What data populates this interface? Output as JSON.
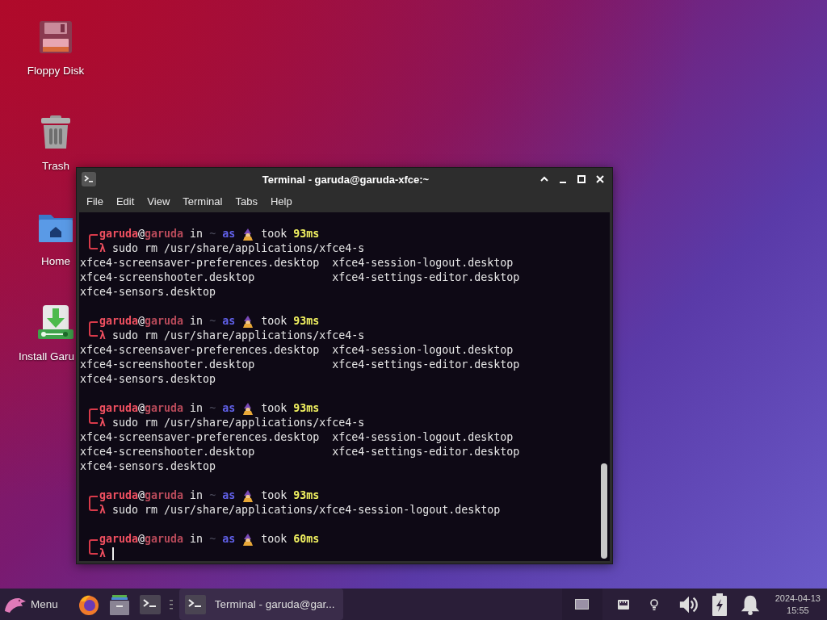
{
  "desktop_icons": [
    {
      "kind": "floppy",
      "label": "Floppy Disk"
    },
    {
      "kind": "trash",
      "label": "Trash"
    },
    {
      "kind": "home",
      "label": "Home"
    },
    {
      "kind": "installer",
      "label": "Install Garu"
    }
  ],
  "terminal": {
    "title": "Terminal - garuda@garuda-xfce:~",
    "menu": [
      "File",
      "Edit",
      "View",
      "Terminal",
      "Tabs",
      "Help"
    ],
    "blocks": [
      {
        "user": "garuda",
        "at": "@",
        "host": "garuda",
        "in": "in",
        "dir": "~",
        "as": "as",
        "took": "took",
        "time": "93ms",
        "lambda": "λ",
        "command": "sudo rm /usr/share/applications/xfce4-s",
        "output": [
          [
            "xfce4-screensaver-preferences.desktop",
            "xfce4-session-logout.desktop"
          ],
          [
            "xfce4-screenshooter.desktop",
            "xfce4-settings-editor.desktop"
          ],
          [
            "xfce4-sensors.desktop"
          ]
        ],
        "cursor": false
      },
      {
        "user": "garuda",
        "at": "@",
        "host": "garuda",
        "in": "in",
        "dir": "~",
        "as": "as",
        "took": "took",
        "time": "93ms",
        "lambda": "λ",
        "command": "sudo rm /usr/share/applications/xfce4-s",
        "output": [
          [
            "xfce4-screensaver-preferences.desktop",
            "xfce4-session-logout.desktop"
          ],
          [
            "xfce4-screenshooter.desktop",
            "xfce4-settings-editor.desktop"
          ],
          [
            "xfce4-sensors.desktop"
          ]
        ],
        "cursor": false
      },
      {
        "user": "garuda",
        "at": "@",
        "host": "garuda",
        "in": "in",
        "dir": "~",
        "as": "as",
        "took": "took",
        "time": "93ms",
        "lambda": "λ",
        "command": "sudo rm /usr/share/applications/xfce4-s",
        "output": [
          [
            "xfce4-screensaver-preferences.desktop",
            "xfce4-session-logout.desktop"
          ],
          [
            "xfce4-screenshooter.desktop",
            "xfce4-settings-editor.desktop"
          ],
          [
            "xfce4-sensors.desktop"
          ]
        ],
        "cursor": false
      },
      {
        "user": "garuda",
        "at": "@",
        "host": "garuda",
        "in": "in",
        "dir": "~",
        "as": "as",
        "took": "took",
        "time": "93ms",
        "lambda": "λ",
        "command": "sudo rm /usr/share/applications/xfce4-session-logout.desktop",
        "cursor": false
      },
      {
        "user": "garuda",
        "at": "@",
        "host": "garuda",
        "in": "in",
        "dir": "~",
        "as": "as",
        "took": "took",
        "time": "60ms",
        "lambda": "λ",
        "cursor": true
      }
    ]
  },
  "taskbar": {
    "menu_label": "Menu",
    "launchers": [
      {
        "kind": "browser"
      },
      {
        "kind": "files"
      },
      {
        "kind": "terminal"
      }
    ],
    "tasks": [
      {
        "title": "Terminal - garuda@gar...",
        "selected": true
      }
    ],
    "tray": [
      {
        "kind": "workspace"
      },
      {
        "kind": "network"
      },
      {
        "kind": "bulb"
      },
      {
        "kind": "volume"
      },
      {
        "kind": "battery"
      },
      {
        "kind": "bell"
      }
    ],
    "clock": {
      "date": "2024-04-13",
      "time": "15:55"
    }
  }
}
